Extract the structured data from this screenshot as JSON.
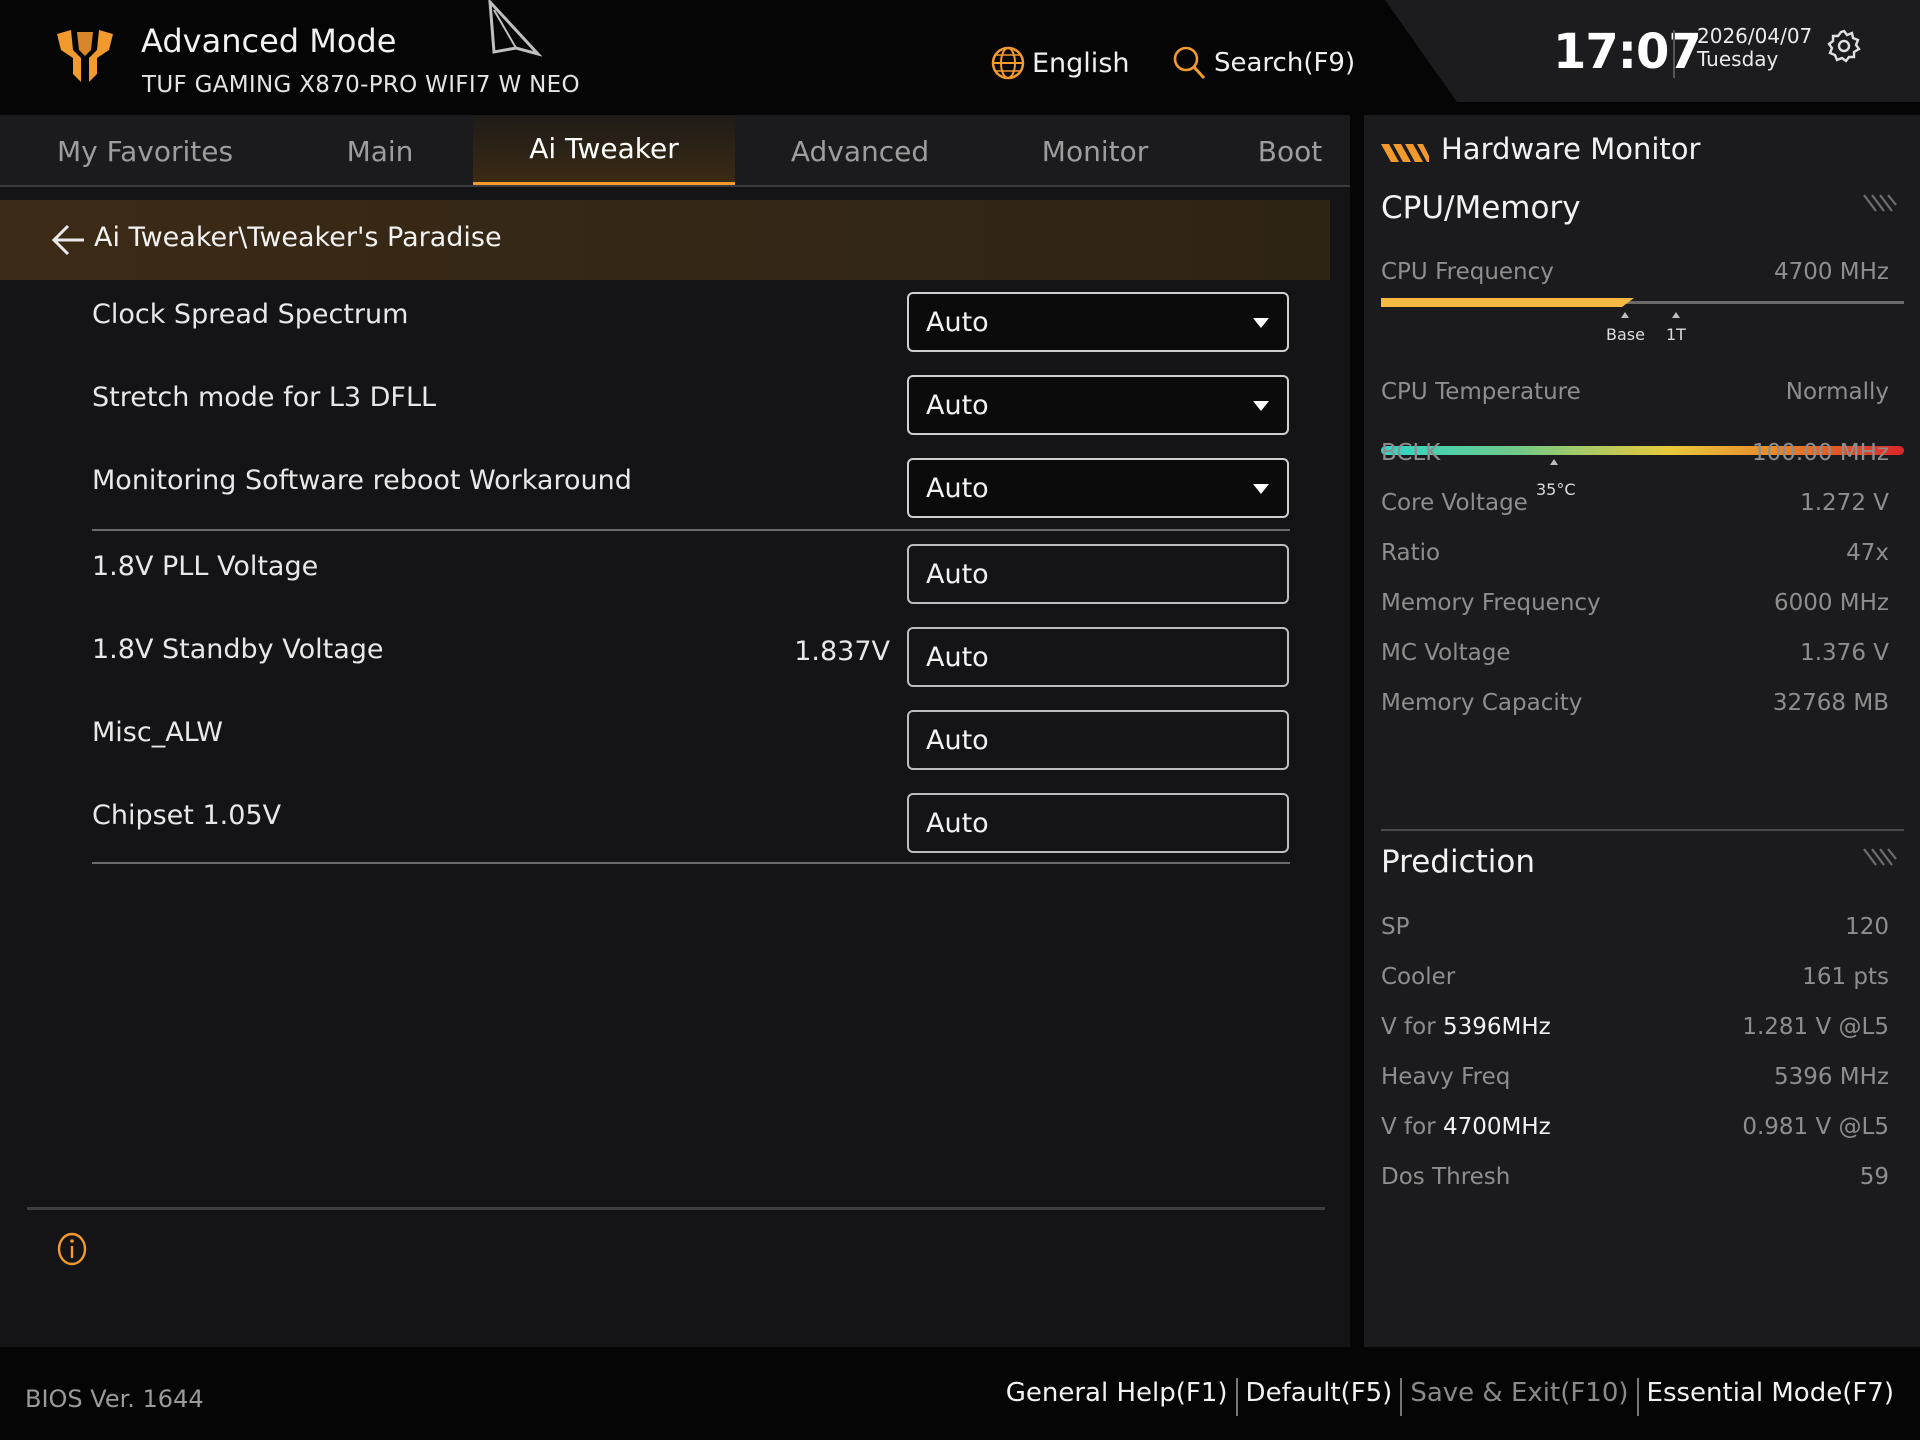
{
  "header": {
    "mode_title": "Advanced Mode",
    "board_name": "TUF GAMING X870-PRO WIFI7 W NEO",
    "language_label": "English",
    "search_label": "Search(F9)",
    "clock": "17:07",
    "date": "2026/04/07",
    "weekday": "Tuesday",
    "icons": [
      "tuf-logo-icon",
      "cursor-pointer-icon",
      "globe-icon",
      "search-icon",
      "gear-icon"
    ]
  },
  "tabs": [
    {
      "label": "My Favorites",
      "active": false
    },
    {
      "label": "Main",
      "active": false
    },
    {
      "label": "Ai Tweaker",
      "active": true
    },
    {
      "label": "Advanced",
      "active": false
    },
    {
      "label": "Monitor",
      "active": false
    },
    {
      "label": "Boot",
      "active": false
    }
  ],
  "breadcrumb": "Ai Tweaker\\Tweaker's Paradise",
  "settings": [
    {
      "label": "Clock Spread Spectrum",
      "control": "dropdown",
      "value": "Auto",
      "reading": ""
    },
    {
      "label": "Stretch mode for L3 DFLL",
      "control": "dropdown",
      "value": "Auto",
      "reading": ""
    },
    {
      "label": "Monitoring Software reboot Workaround",
      "control": "dropdown",
      "value": "Auto",
      "reading": ""
    },
    {
      "label": "1.8V PLL Voltage",
      "control": "input",
      "value": "Auto",
      "reading": ""
    },
    {
      "label": "1.8V Standby Voltage",
      "control": "input",
      "value": "Auto",
      "reading": "1.837V"
    },
    {
      "label": "Misc_ALW",
      "control": "input",
      "value": "Auto",
      "reading": ""
    },
    {
      "label": "Chipset 1.05V",
      "control": "input",
      "value": "Auto",
      "reading": ""
    }
  ],
  "hardware_monitor": {
    "title": "Hardware Monitor",
    "cpu_memory": {
      "title": "CPU/Memory",
      "cpu_frequency": {
        "label": "CPU Frequency",
        "value": "4700 MHz",
        "fill_fraction": 0.46,
        "tick_base": "Base",
        "tick_1t": "1T"
      },
      "cpu_temperature": {
        "label": "CPU Temperature",
        "value": "Normally",
        "marker": "35°C",
        "marker_fraction": 0.33
      },
      "rows": [
        {
          "label": "BCLK",
          "value": "100.00 MHz"
        },
        {
          "label": "Core Voltage",
          "value": "1.272 V"
        },
        {
          "label": "Ratio",
          "value": "47x"
        },
        {
          "label": "Memory Frequency",
          "value": "6000 MHz"
        },
        {
          "label": "MC Voltage",
          "value": "1.376 V"
        },
        {
          "label": "Memory Capacity",
          "value": "32768 MB"
        }
      ]
    },
    "prediction": {
      "title": "Prediction",
      "rows": [
        {
          "label": "SP",
          "highlight": "",
          "value": "120"
        },
        {
          "label": "Cooler",
          "highlight": "",
          "value": "161 pts"
        },
        {
          "label": "V for ",
          "highlight": "5396MHz",
          "value": "1.281 V @L5"
        },
        {
          "label": "Heavy Freq",
          "highlight": "",
          "value": "5396 MHz"
        },
        {
          "label": "V for ",
          "highlight": "4700MHz",
          "value": "0.981 V @L5"
        },
        {
          "label": "Dos Thresh",
          "highlight": "",
          "value": "59"
        }
      ]
    }
  },
  "footer": {
    "bios_version": "BIOS Ver. 1644",
    "links": [
      {
        "label": "General Help(F1)",
        "dim": false
      },
      {
        "label": "Default(F5)",
        "dim": false
      },
      {
        "label": "Save & Exit(F10)",
        "dim": true
      },
      {
        "label": "Essential Mode(F7)",
        "dim": false
      }
    ]
  },
  "colors": {
    "accent": "#f29a2e",
    "breadcrumb_bg": "#3b2a16",
    "freq_fill": "#f5b942"
  }
}
